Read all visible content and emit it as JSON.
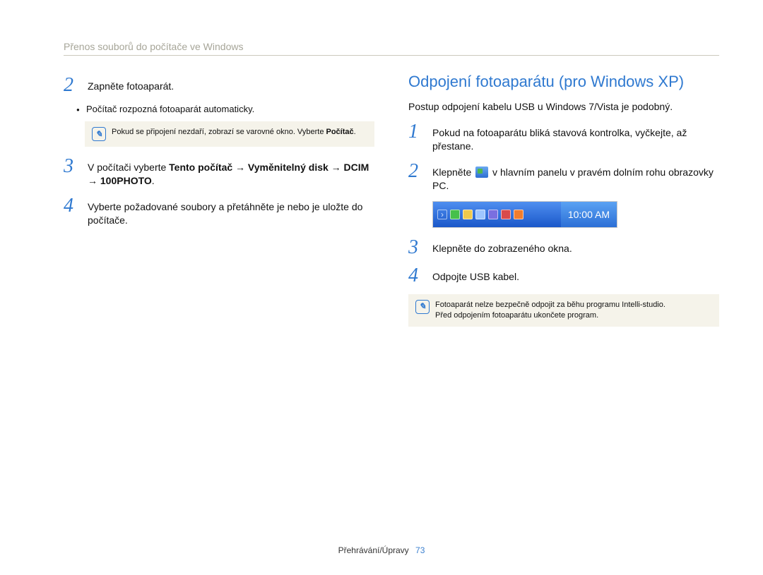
{
  "header": "Přenos souborů do počítače ve Windows",
  "left": {
    "step2": "Zapněte fotoaparát.",
    "bullet": "Počítač rozpozná fotoaparát automaticky.",
    "note_text": "Pokud se připojení nezdaří, zobrazí se varovné okno. Vyberte ",
    "note_bold": "Počítač",
    "note_tail": ".",
    "step3_a": "V počítači vyberte ",
    "step3_b": "Tento počítač → Vyměnitelný disk → DCIM → 100PHOTO",
    "step3_c": ".",
    "step4": "Vyberte požadované soubory a přetáhněte je nebo je uložte do počítače."
  },
  "right": {
    "title": "Odpojení fotoaparátu (pro Windows XP)",
    "lead": "Postup odpojení kabelu USB u Windows 7/Vista je podobný.",
    "step1": "Pokud na fotoaparátu bliká stavová kontrolka, vyčkejte, až přestane.",
    "step2_a": "Klepněte ",
    "step2_b": " v hlavním panelu v pravém dolním rohu obrazovky PC.",
    "clock": "10:00 AM",
    "step3": "Klepněte do zobrazeného okna.",
    "step4": "Odpojte USB kabel.",
    "note1": "Fotoaparát nelze bezpečně odpojit za běhu programu Intelli-studio.",
    "note2": "Před odpojením fotoaparátu ukončete program."
  },
  "footer": {
    "section": "Přehrávání/Úpravy",
    "page": "73"
  },
  "nums": {
    "n1": "1",
    "n2": "2",
    "n3": "3",
    "n4": "4"
  }
}
